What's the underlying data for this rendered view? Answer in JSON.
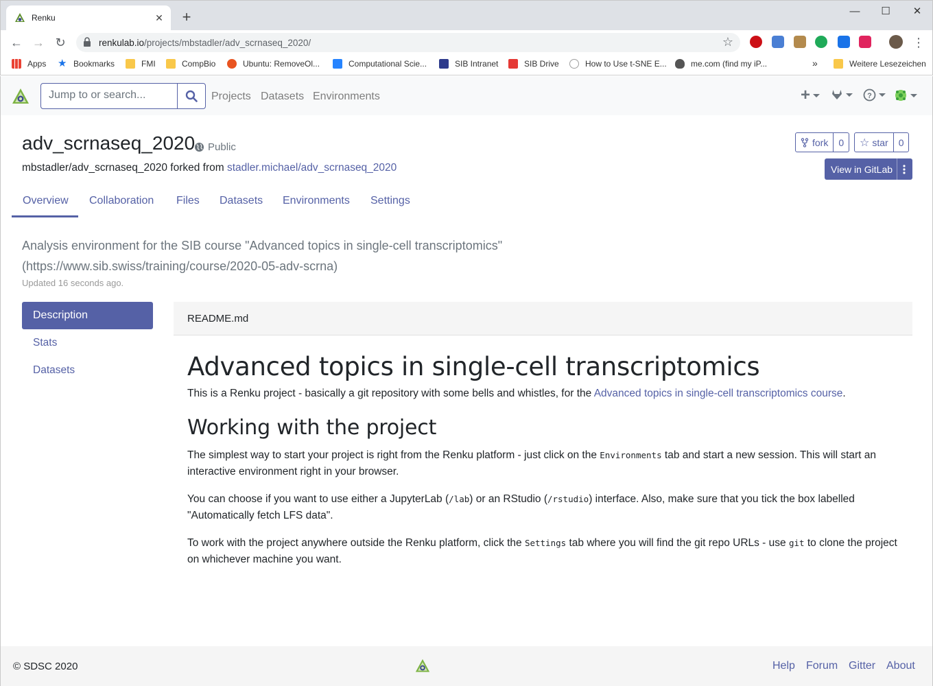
{
  "browser": {
    "tab_title": "Renku",
    "url_host": "renkulab.io",
    "url_path": "/projects/mbstadler/adv_scrnaseq_2020/",
    "bookmarks": [
      {
        "label": "Apps",
        "color": "#4285f4"
      },
      {
        "label": "Bookmarks",
        "color": "#1a73e8"
      },
      {
        "label": "FMI",
        "color": "#f9c84a"
      },
      {
        "label": "CompBio",
        "color": "#f9c84a"
      },
      {
        "label": "Ubuntu: RemoveOl...",
        "color": "#e95420"
      },
      {
        "label": "Computational Scie...",
        "color": "#2684ff"
      },
      {
        "label": "SIB Intranet",
        "color": "#2d3a8c"
      },
      {
        "label": "SIB Drive",
        "color": "#e53935"
      },
      {
        "label": "How to Use t-SNE E...",
        "color": "#9e9e9e"
      },
      {
        "label": "me.com (find my iP...",
        "color": "#555555"
      },
      {
        "label": "Weitere Lesezeichen",
        "color": "#f9c84a"
      }
    ],
    "overflow_label": "»"
  },
  "navbar": {
    "search_placeholder": "Jump to or search...",
    "links": [
      "Projects",
      "Datasets",
      "Environments"
    ]
  },
  "project": {
    "title": "adv_scrnaseq_2020",
    "visibility": "Public",
    "path": "mbstadler/adv_scrnaseq_2020",
    "forked_text": "forked from",
    "forked_from": "stadler.michael/adv_scrnaseq_2020",
    "fork_label": "fork",
    "fork_count": "0",
    "star_label": "star",
    "star_count": "0",
    "gitlab_label": "View in GitLab",
    "tabs": [
      "Overview",
      "Collaboration",
      "Files",
      "Datasets",
      "Environments",
      "Settings"
    ],
    "description": "Analysis environment for the SIB course \"Advanced topics in single-cell transcriptomics\" (https://www.sib.swiss/training/course/2020-05-adv-scrna)",
    "updated": "Updated 16 seconds ago."
  },
  "sidenav": [
    "Description",
    "Stats",
    "Datasets"
  ],
  "readme": {
    "filename": "README.md",
    "h1": "Advanced topics in single-cell transcriptomics",
    "p1_before": "This is a Renku project - basically a git repository with some bells and whistles, for the ",
    "p1_link": "Advanced topics in single-cell transcriptomics course",
    "p1_after": ".",
    "h2": "Working with the project",
    "p2_a": "The simplest way to start your project is right from the Renku platform - just click on the ",
    "p2_code": "Environments",
    "p2_b": " tab and start a new session. This will start an interactive environment right in your browser.",
    "p3_a": "You can choose if you want to use either a JupyterLab (",
    "p3_code1": "/lab",
    "p3_b": ") or an RStudio (",
    "p3_code2": "/rstudio",
    "p3_c": ") interface. Also, make sure that you tick the box labelled \"Automatically fetch LFS data\".",
    "p4_a": "To work with the project anywhere outside the Renku platform, click the ",
    "p4_code1": "Settings",
    "p4_b": " tab where you will find the git repo URLs - use ",
    "p4_code2": "git",
    "p4_c": " to clone the project on whichever machine you want."
  },
  "footer": {
    "copyright": "© SDSC 2020",
    "links": [
      "Help",
      "Forum",
      "Gitter",
      "About"
    ]
  },
  "colors": {
    "accent": "#5561a6",
    "muted": "#6c757d"
  }
}
